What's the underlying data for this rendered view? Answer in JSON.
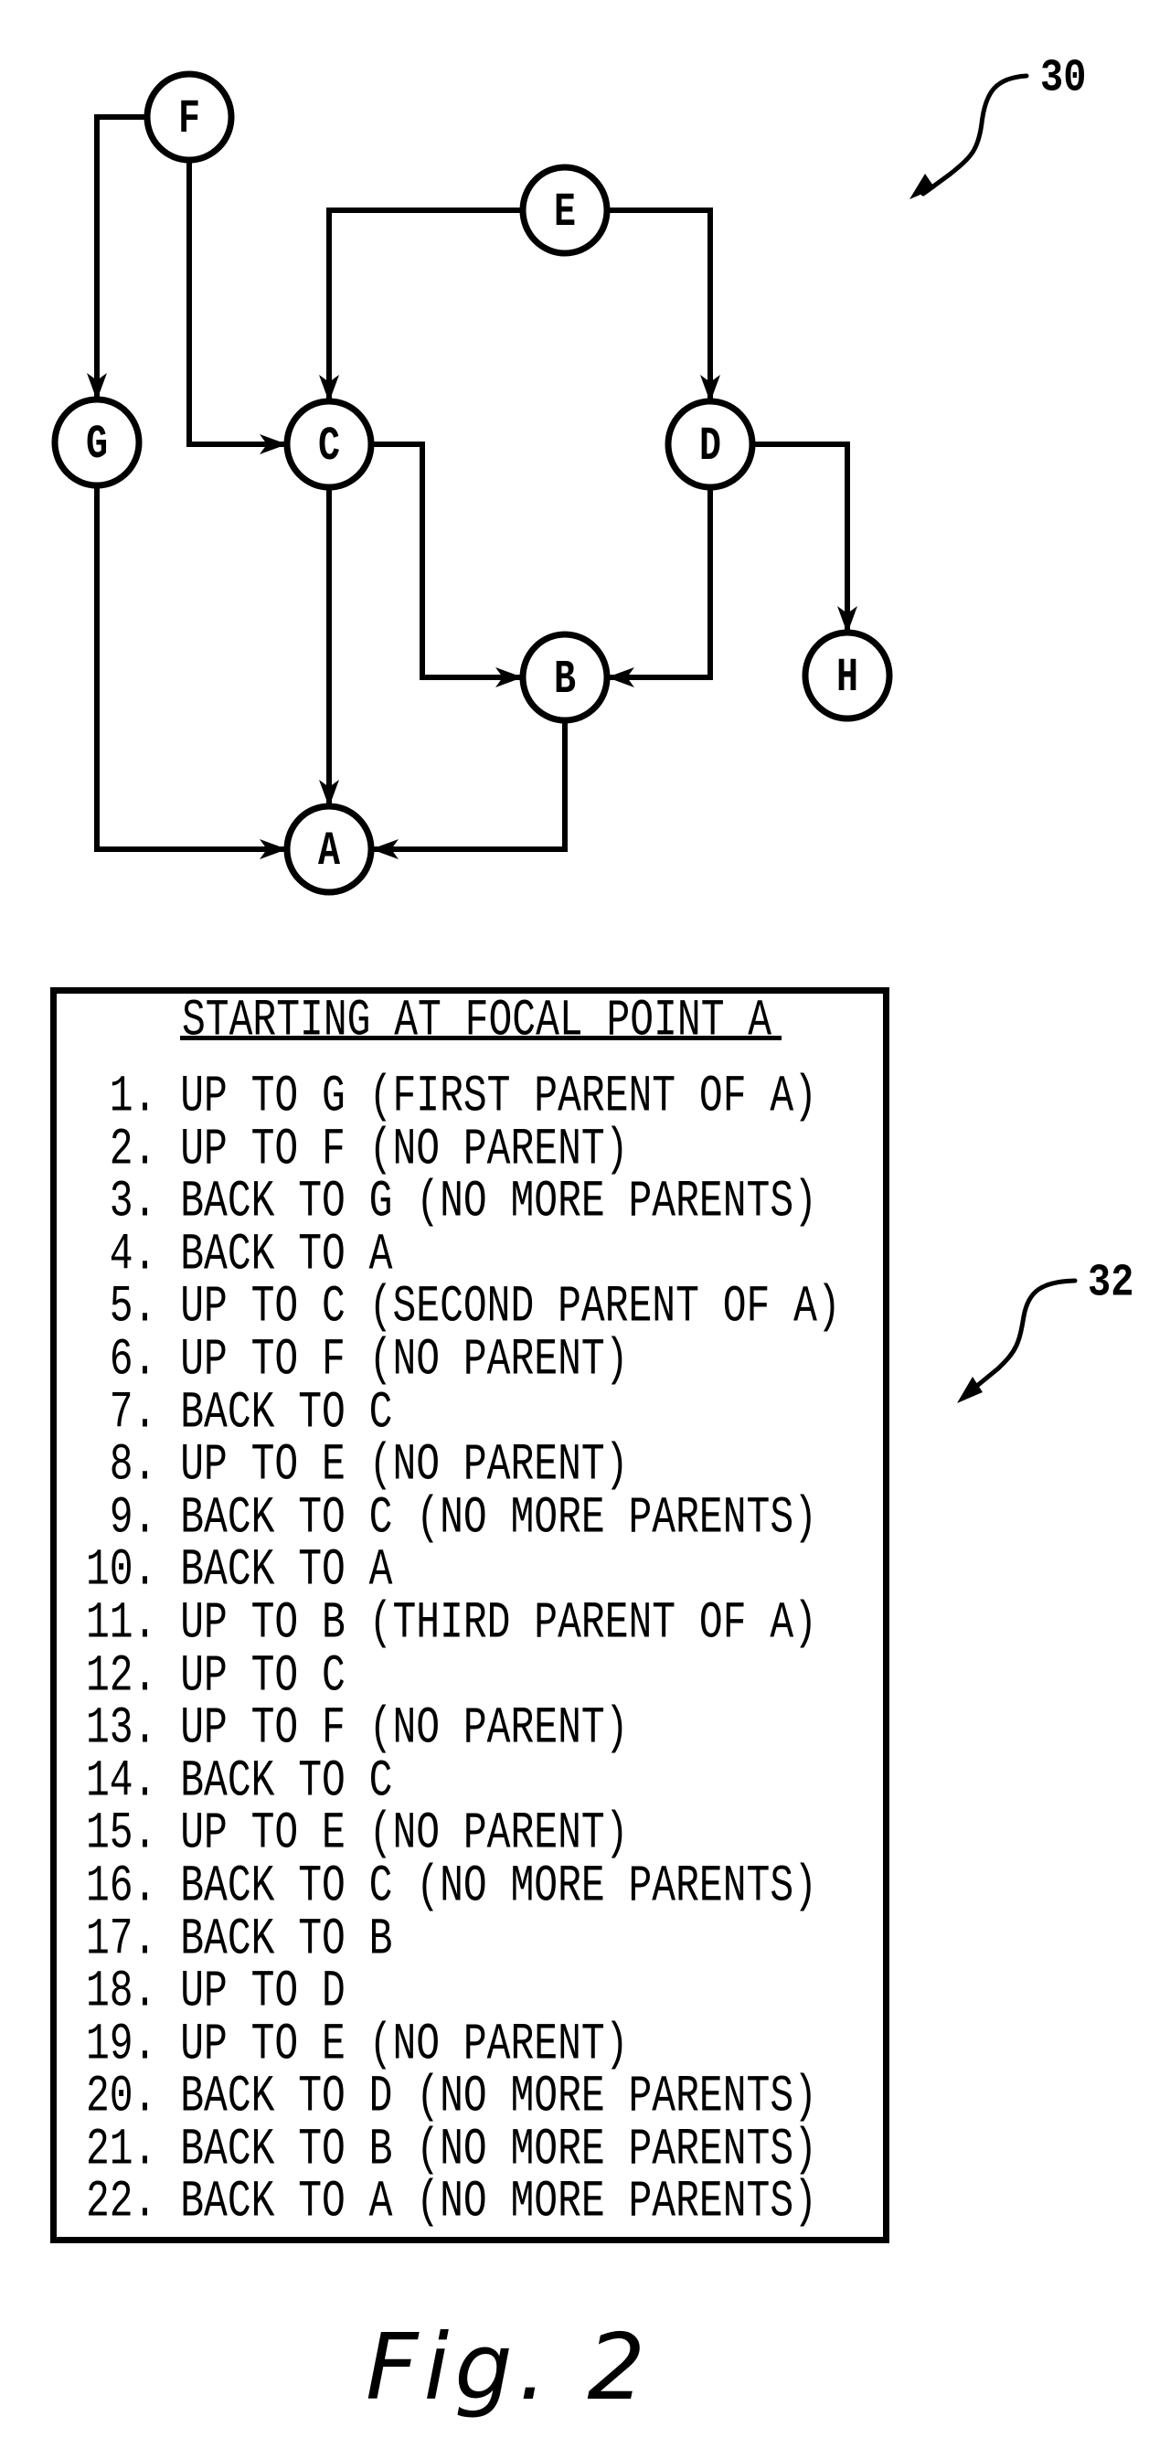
{
  "diagram": {
    "reference_numeral": "30",
    "nodes": [
      {
        "id": "F",
        "label": "F"
      },
      {
        "id": "E",
        "label": "E"
      },
      {
        "id": "G",
        "label": "G"
      },
      {
        "id": "C",
        "label": "C"
      },
      {
        "id": "D",
        "label": "D"
      },
      {
        "id": "B",
        "label": "B"
      },
      {
        "id": "H",
        "label": "H"
      },
      {
        "id": "A",
        "label": "A"
      }
    ],
    "edges": [
      {
        "from": "F",
        "to": "G"
      },
      {
        "from": "F",
        "to": "C"
      },
      {
        "from": "E",
        "to": "C"
      },
      {
        "from": "E",
        "to": "D"
      },
      {
        "from": "C",
        "to": "A"
      },
      {
        "from": "C",
        "to": "B"
      },
      {
        "from": "D",
        "to": "B"
      },
      {
        "from": "D",
        "to": "H"
      },
      {
        "from": "G",
        "to": "A"
      },
      {
        "from": "B",
        "to": "A"
      }
    ]
  },
  "traversal": {
    "reference_numeral": "32",
    "title": "STARTING AT FOCAL POINT A",
    "steps": [
      {
        "num": "1.",
        "text": "UP TO G (FIRST PARENT OF A)"
      },
      {
        "num": "2.",
        "text": "UP TO F (NO PARENT)"
      },
      {
        "num": "3.",
        "text": "BACK TO G (NO MORE PARENTS)"
      },
      {
        "num": "4.",
        "text": "BACK TO A"
      },
      {
        "num": "5.",
        "text": "UP TO C (SECOND PARENT OF A)"
      },
      {
        "num": "6.",
        "text": "UP TO F (NO PARENT)"
      },
      {
        "num": "7.",
        "text": "BACK TO C"
      },
      {
        "num": "8.",
        "text": "UP TO E (NO PARENT)"
      },
      {
        "num": "9.",
        "text": "BACK TO C (NO MORE PARENTS)"
      },
      {
        "num": "10.",
        "text": "BACK TO A"
      },
      {
        "num": "11.",
        "text": "UP TO B (THIRD PARENT OF A)"
      },
      {
        "num": "12.",
        "text": "UP TO C"
      },
      {
        "num": "13.",
        "text": "UP TO F (NO PARENT)"
      },
      {
        "num": "14.",
        "text": "BACK TO C"
      },
      {
        "num": "15.",
        "text": "UP TO E (NO PARENT)"
      },
      {
        "num": "16.",
        "text": "BACK TO C (NO MORE PARENTS)"
      },
      {
        "num": "17.",
        "text": "BACK TO B"
      },
      {
        "num": "18.",
        "text": "UP TO D"
      },
      {
        "num": "19.",
        "text": "UP TO E (NO PARENT)"
      },
      {
        "num": "20.",
        "text": "BACK TO D (NO MORE PARENTS)"
      },
      {
        "num": "21.",
        "text": "BACK TO B (NO MORE PARENTS)"
      },
      {
        "num": "22.",
        "text": "BACK TO A (NO MORE PARENTS)"
      }
    ]
  },
  "caption": "Fig. 2"
}
